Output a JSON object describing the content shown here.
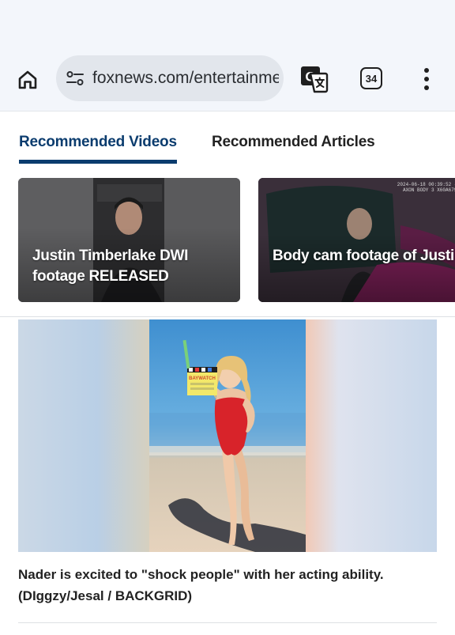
{
  "browser": {
    "url": "foxnews.com/entertainme",
    "tab_count": "34"
  },
  "section_tabs": [
    {
      "label": "Recommended Videos",
      "active": true
    },
    {
      "label": "Recommended Articles",
      "active": false
    }
  ],
  "videos": [
    {
      "title": "Justin Timberlake DWI\nfootage RELEASED"
    },
    {
      "title": "Body cam footage of Justi\nTimberlake's arrest in the..."
    }
  ],
  "article": {
    "clapperboard_text": "BAYWATCH",
    "caption": "Nader is excited to \"shock people\" with her acting ability.",
    "credit": "(DIggzy/Jesal / BACKGRID)"
  },
  "colors": {
    "accent": "#0b3c6e",
    "toolbar_bg": "#f3f6fb",
    "url_pill_bg": "#e2e6ec"
  }
}
